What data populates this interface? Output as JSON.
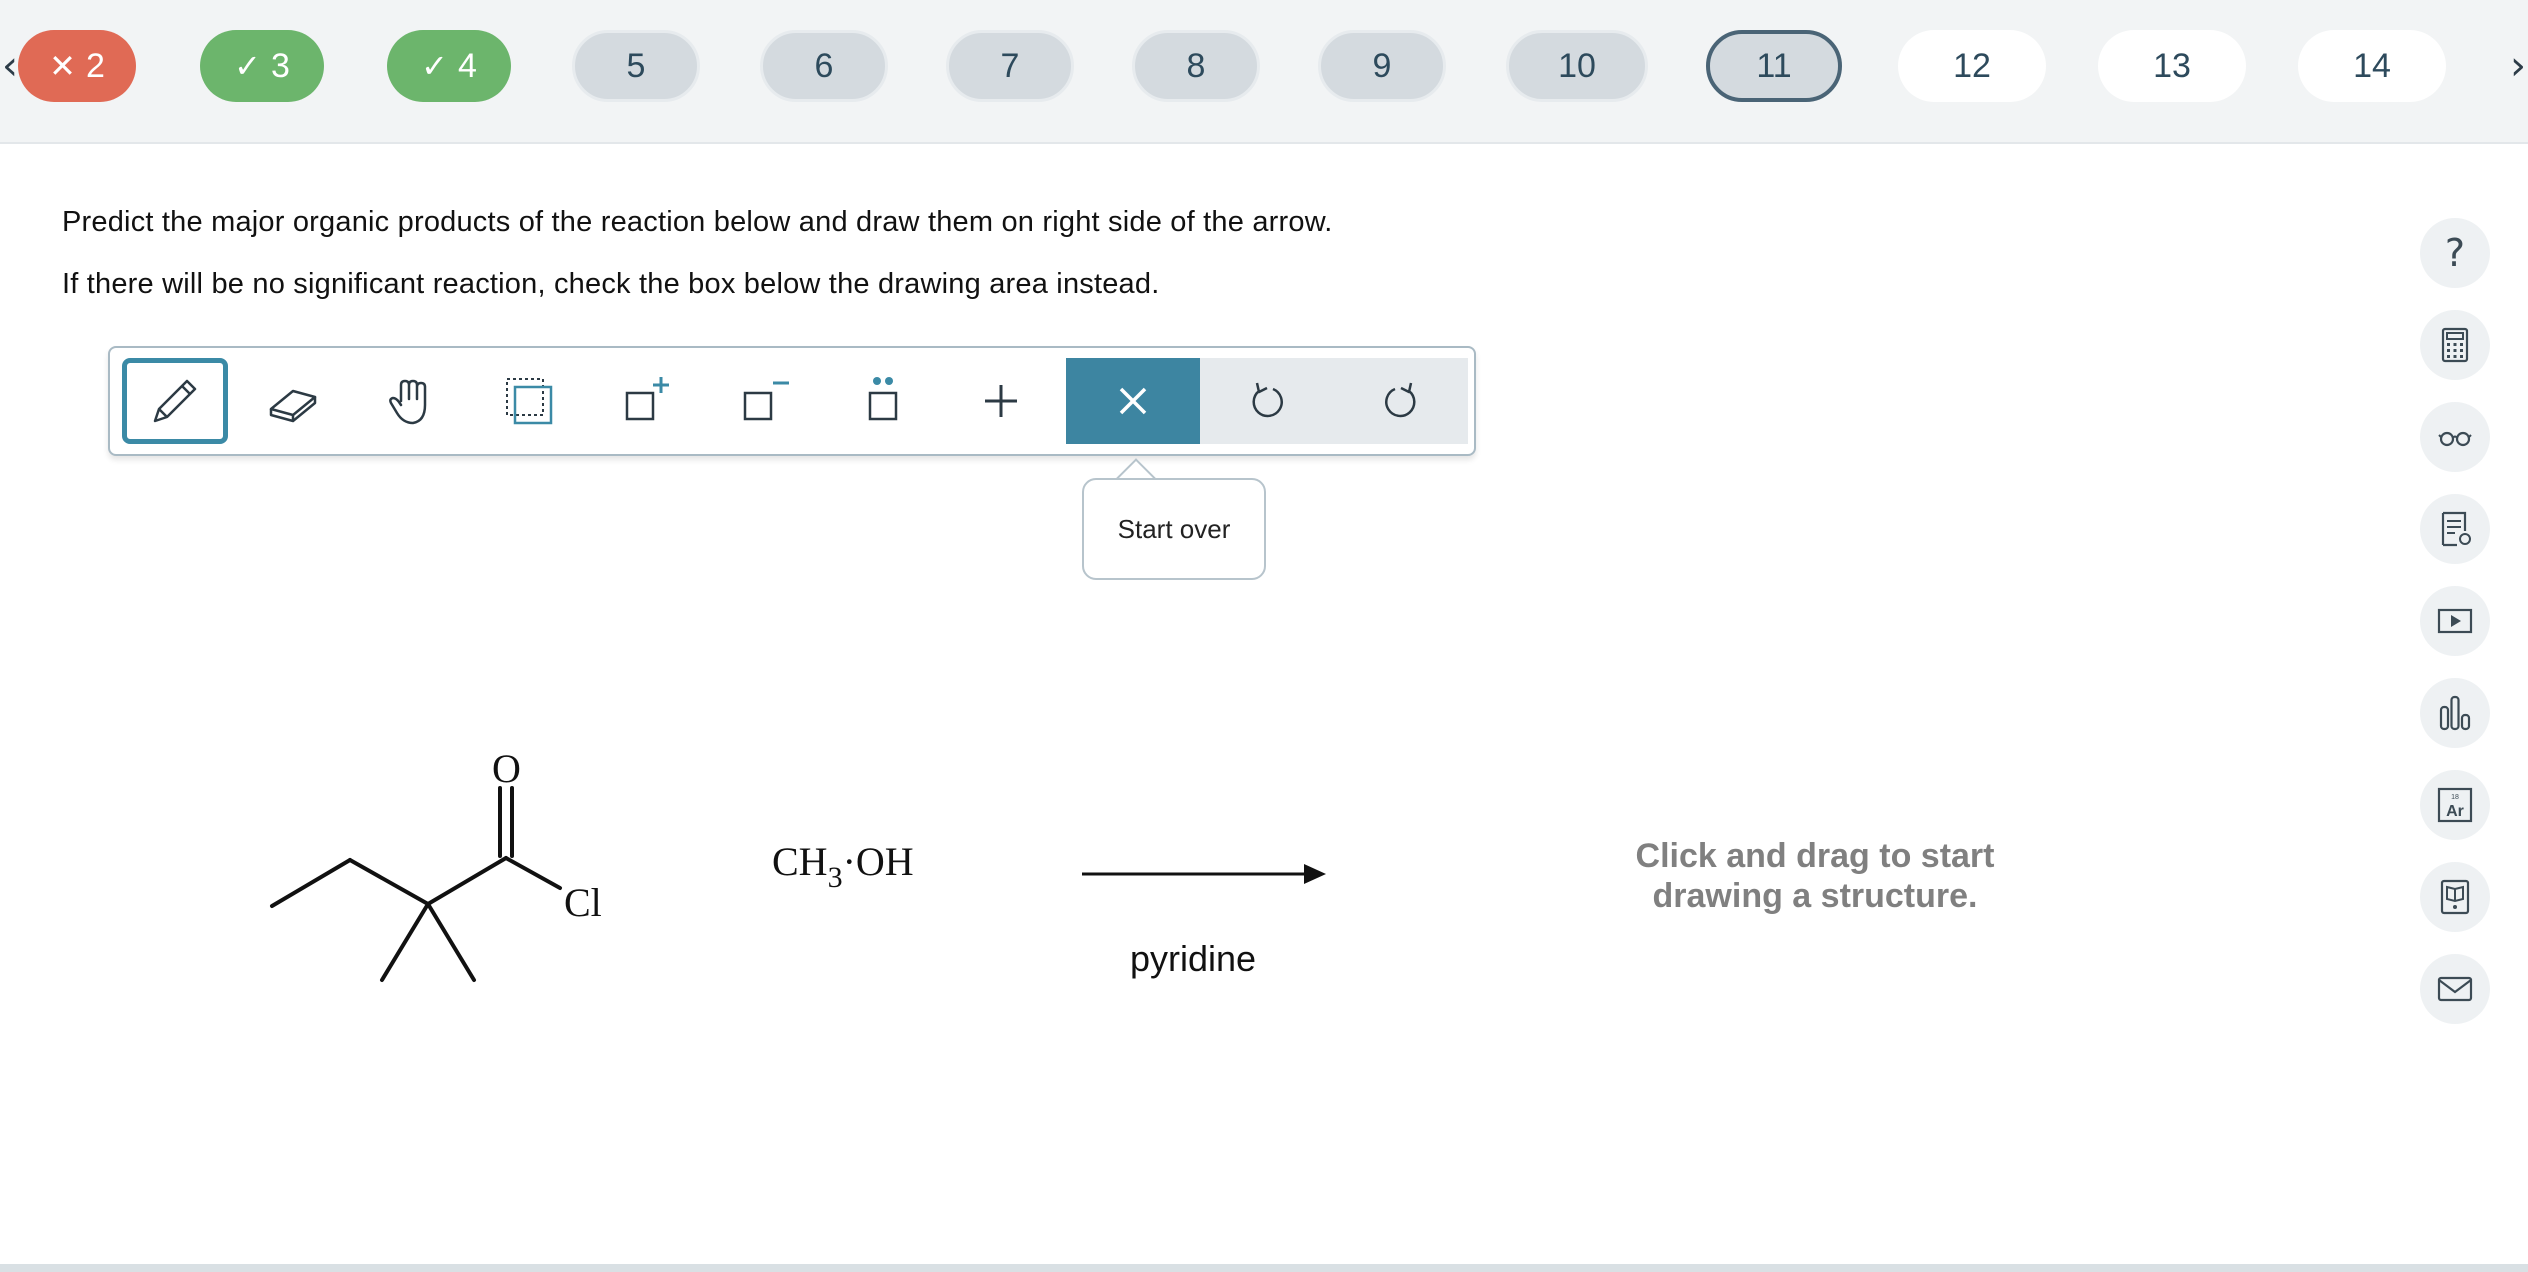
{
  "nav": {
    "prev_icon": "chevron-left-icon",
    "next_icon": "chevron-right-icon",
    "prev_glyph": "‹",
    "next_glyph": "›",
    "questions": [
      {
        "label": "2",
        "status": "wrong",
        "glyph": "✕"
      },
      {
        "label": "3",
        "status": "right",
        "glyph": "✓"
      },
      {
        "label": "4",
        "status": "right",
        "glyph": "✓"
      },
      {
        "label": "5",
        "status": "visited",
        "glyph": ""
      },
      {
        "label": "6",
        "status": "visited",
        "glyph": ""
      },
      {
        "label": "7",
        "status": "visited",
        "glyph": ""
      },
      {
        "label": "8",
        "status": "visited",
        "glyph": ""
      },
      {
        "label": "9",
        "status": "visited",
        "glyph": ""
      },
      {
        "label": "10",
        "status": "visited",
        "glyph": ""
      },
      {
        "label": "11",
        "status": "current",
        "glyph": ""
      },
      {
        "label": "12",
        "status": "unvisited",
        "glyph": ""
      },
      {
        "label": "13",
        "status": "unvisited",
        "glyph": ""
      },
      {
        "label": "14",
        "status": "unvisited",
        "glyph": ""
      }
    ]
  },
  "instructions": {
    "line1": "Predict the major organic products of the reaction below and draw them on right side of the arrow.",
    "line2": "If there will be no significant reaction, check the box below the drawing area instead."
  },
  "toolbar": {
    "tools": [
      "pencil-icon",
      "eraser-icon",
      "hand-icon",
      "select-icon",
      "add-charge-icon",
      "remove-charge-icon",
      "lone-pair-icon",
      "plus-icon",
      "close-icon",
      "undo-icon",
      "redo-icon"
    ],
    "active_tool": "pencil-icon",
    "tooltip": "Start over"
  },
  "reaction": {
    "reactant_atoms": {
      "oxygen": "O",
      "chlorine": "Cl"
    },
    "reagent": {
      "formula_main": "CH",
      "formula_sub": "3",
      "formula_rest": "·OH"
    },
    "condition": "pyridine",
    "draw_hint_line1": "Click and drag to start",
    "draw_hint_line2": "drawing a structure."
  },
  "rail": {
    "help_glyph": "?",
    "buttons": [
      "help-icon",
      "calculator-icon",
      "glasses-icon",
      "notes-icon",
      "video-icon",
      "bar-chart-icon",
      "periodic-table-icon",
      "ebook-icon",
      "mail-icon"
    ],
    "periodic_number": "18",
    "periodic_symbol": "Ar"
  },
  "colors": {
    "wrong": "#e06a55",
    "right": "#6cb56c",
    "accent": "#3d85a1",
    "current_border": "#4a6476"
  }
}
